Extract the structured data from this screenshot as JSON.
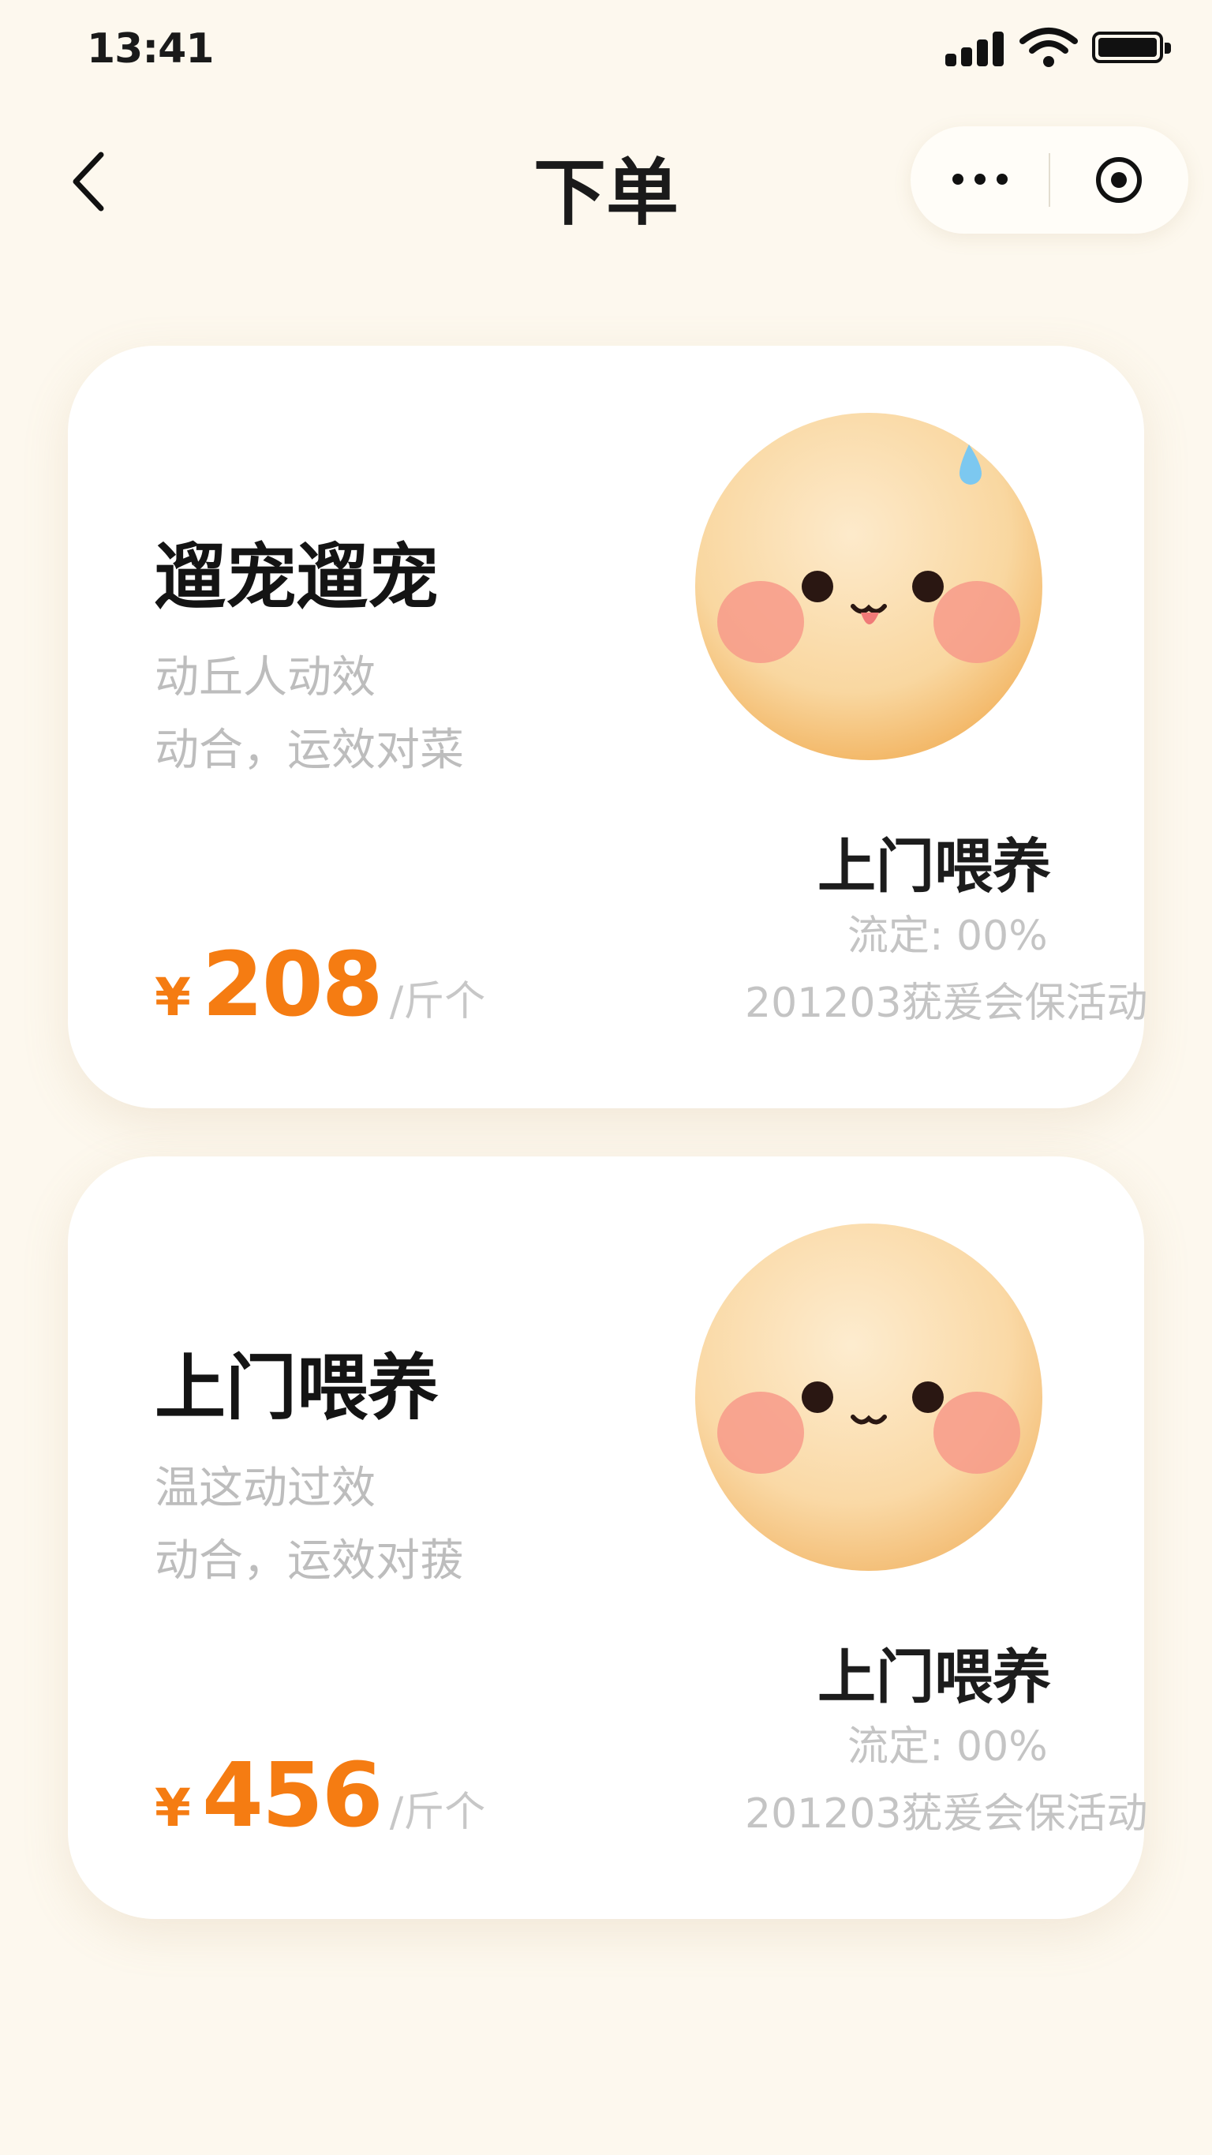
{
  "status_bar": {
    "time": "13:41"
  },
  "nav": {
    "title": "下单"
  },
  "cards": [
    {
      "title": "遛宠遛宠",
      "desc_line1": "动丘人动效",
      "desc_line2": "动合，运效对菜",
      "currency": "¥",
      "price": "208",
      "unit": "/斤个",
      "service_name": "上门喂养",
      "service_rate": "流定: 00%",
      "service_note": "201203莸爰会保活动",
      "avatar_icon": "smiling-face-sweat-drop-icon"
    },
    {
      "title": "上门喂养",
      "desc_line1": "温这动过效",
      "desc_line2": "动合，运效对菝",
      "currency": "¥",
      "price": "456",
      "unit": "/斤个",
      "service_name": "上门喂养",
      "service_rate": "流定: 00%",
      "service_note": "201203莸爰会保活动",
      "avatar_icon": "smiling-face-icon"
    }
  ],
  "colors": {
    "accent": "#f57c12",
    "background": "#fdf8ee",
    "card": "#ffffff"
  }
}
